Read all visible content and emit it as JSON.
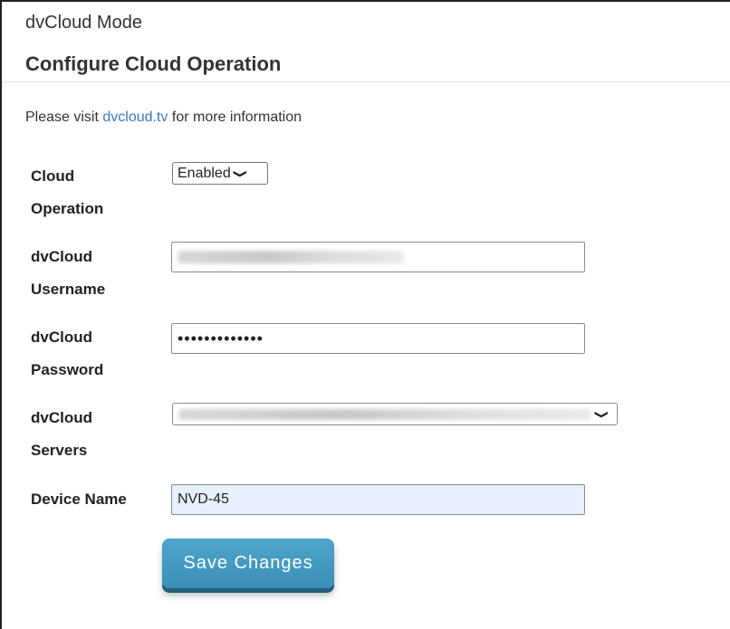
{
  "header": {
    "mode_title": "dvCloud Mode",
    "section_title": "Configure Cloud Operation"
  },
  "info": {
    "prefix": "Please visit ",
    "link_text": "dvcloud.tv",
    "suffix": " for more information"
  },
  "form": {
    "cloud_operation": {
      "label_line1": "Cloud",
      "label_line2": "Operation",
      "selected": "Enabled"
    },
    "username": {
      "label_line1": "dvCloud",
      "label_line2": "Username"
    },
    "password": {
      "label_line1": "dvCloud",
      "label_line2": "Password",
      "value_masked": "•••••••••••••"
    },
    "servers": {
      "label_line1": "dvCloud",
      "label_line2": "Servers"
    },
    "device_name": {
      "label": "Device Name",
      "value": "NVD-45"
    },
    "save_label": "Save Changes"
  },
  "icons": {
    "dropdown": "chevron-down-icon"
  },
  "colors": {
    "link": "#3b7ab8",
    "button": "#3a8fb7",
    "autofill_bg": "#e8f0fe"
  }
}
